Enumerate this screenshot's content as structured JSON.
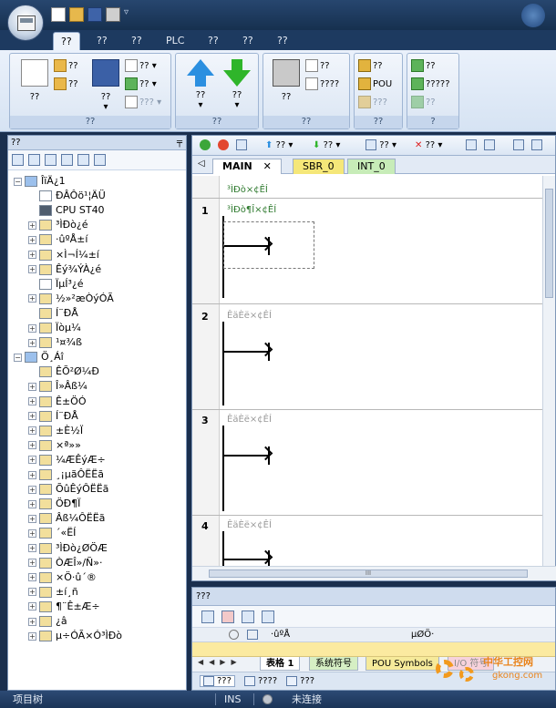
{
  "ribbon_tabs": [
    "??",
    "??",
    "??",
    "PLC",
    "??",
    "??",
    "??"
  ],
  "ribbon": {
    "g1": {
      "label": "??",
      "new": "??",
      "open": "??",
      "close": "??",
      "save": "??",
      "import": "??",
      "export": "??",
      "prev": "???"
    },
    "g2": {
      "label": "??",
      "upload": "??",
      "download": "??"
    },
    "g3": {
      "label": "??",
      "print": "??",
      "preview": "??",
      "setup": "????"
    },
    "g4": {
      "label": "??",
      "pou": "POU",
      "item1": "??",
      "item2": "???"
    },
    "g5": {
      "label": "?",
      "item1": "??",
      "item2": "?????",
      "item3": "??"
    }
  },
  "left_panel": {
    "title": "??",
    "tree": [
      {
        "text": "ÎïÄ¿1",
        "level": 0,
        "expander": "−"
      },
      {
        "text": "ÐÂÔö¹¦ÄÜ",
        "level": 1
      },
      {
        "text": "CPU ST40",
        "level": 1
      },
      {
        "text": "³ÌÐò¿é",
        "level": 1,
        "expander": "+"
      },
      {
        "text": "·ûºÅ±í",
        "level": 1,
        "expander": "+"
      },
      {
        "text": "×Ì¬Í¼±í",
        "level": 1,
        "expander": "+"
      },
      {
        "text": "Êý¾ÝÀ¿é",
        "level": 1,
        "expander": "+"
      },
      {
        "text": "ÏµÍ³¿é",
        "level": 1
      },
      {
        "text": "½»²æÒýÓÃ",
        "level": 1,
        "expander": "+"
      },
      {
        "text": "Í¨ÐÅ",
        "level": 1
      },
      {
        "text": "Ïòµ¼",
        "level": 1,
        "expander": "+"
      },
      {
        "text": "¹¤¾ß",
        "level": 1,
        "expander": "+"
      },
      {
        "text": "Ö¸Áî",
        "level": 0,
        "expander": "−"
      },
      {
        "text": "ÊÕ²Ø¼Ð",
        "level": 1
      },
      {
        "text": "Î»Âß¼­",
        "level": 1,
        "expander": "+"
      },
      {
        "text": "Ê±ÖÓ",
        "level": 1,
        "expander": "+"
      },
      {
        "text": "Í¨ÐÅ",
        "level": 1,
        "expander": "+"
      },
      {
        "text": "±È½Ï",
        "level": 1,
        "expander": "+"
      },
      {
        "text": "×ª»»",
        "level": 1,
        "expander": "+"
      },
      {
        "text": "¼ÆÊýÆ÷",
        "level": 1,
        "expander": "+"
      },
      {
        "text": "¸¡µãÔËËã",
        "level": 1,
        "expander": "+"
      },
      {
        "text": "ÕûÊýÔËËã",
        "level": 1,
        "expander": "+"
      },
      {
        "text": "ÖÐ¶Ï",
        "level": 1,
        "expander": "+"
      },
      {
        "text": "Âß¼­ÔËËã",
        "level": 1,
        "expander": "+"
      },
      {
        "text": "´«ËÍ",
        "level": 1,
        "expander": "+"
      },
      {
        "text": "³ÌÐò¿ØÖÆ",
        "level": 1,
        "expander": "+"
      },
      {
        "text": "ÒÆÎ»/Ñ­»·",
        "level": 1,
        "expander": "+"
      },
      {
        "text": "×Ö·û´®",
        "level": 1,
        "expander": "+"
      },
      {
        "text": "±í¸ñ",
        "level": 1,
        "expander": "+"
      },
      {
        "text": "¶¨Ê±Æ÷",
        "level": 1,
        "expander": "+"
      },
      {
        "text": "¿â",
        "level": 1,
        "expander": "+"
      },
      {
        "text": "µ÷ÓÃ×Ó³ÌÐò",
        "level": 1,
        "expander": "+"
      }
    ]
  },
  "editor": {
    "toolbar": {
      "upload": "??",
      "download": "??",
      "insert": "??",
      "delete": "??"
    },
    "tabs": [
      "MAIN",
      "SBR_0",
      "INT_0"
    ],
    "close_symbol": "✕",
    "left_arrow": "◁",
    "program_comment": "³ÌÐò×¢ÊÍ",
    "networks": [
      {
        "num": "1",
        "title": "³ÌÐò¶Î×¢ÊÍ"
      },
      {
        "num": "2",
        "title": "ÊäÈë×¢ÊÍ"
      },
      {
        "num": "3",
        "title": "ÊäÈë×¢ÊÍ"
      },
      {
        "num": "4",
        "title": "ÊäÈë×¢ÊÍ"
      }
    ],
    "hscroll_grip": "III"
  },
  "bottom_panel": {
    "title": "???",
    "grid_cols": [
      "·ûºÅ",
      "µØÖ·"
    ],
    "tabs": [
      "表格 1",
      "系统符号",
      "POU Symbols",
      "I/O 符号"
    ],
    "views": [
      "???",
      "????",
      "???"
    ]
  },
  "status": {
    "left": "项目树",
    "mode": "INS",
    "connection": "未连接"
  },
  "watermark": {
    "title": "中华工控网",
    "url": "gkong.com"
  }
}
